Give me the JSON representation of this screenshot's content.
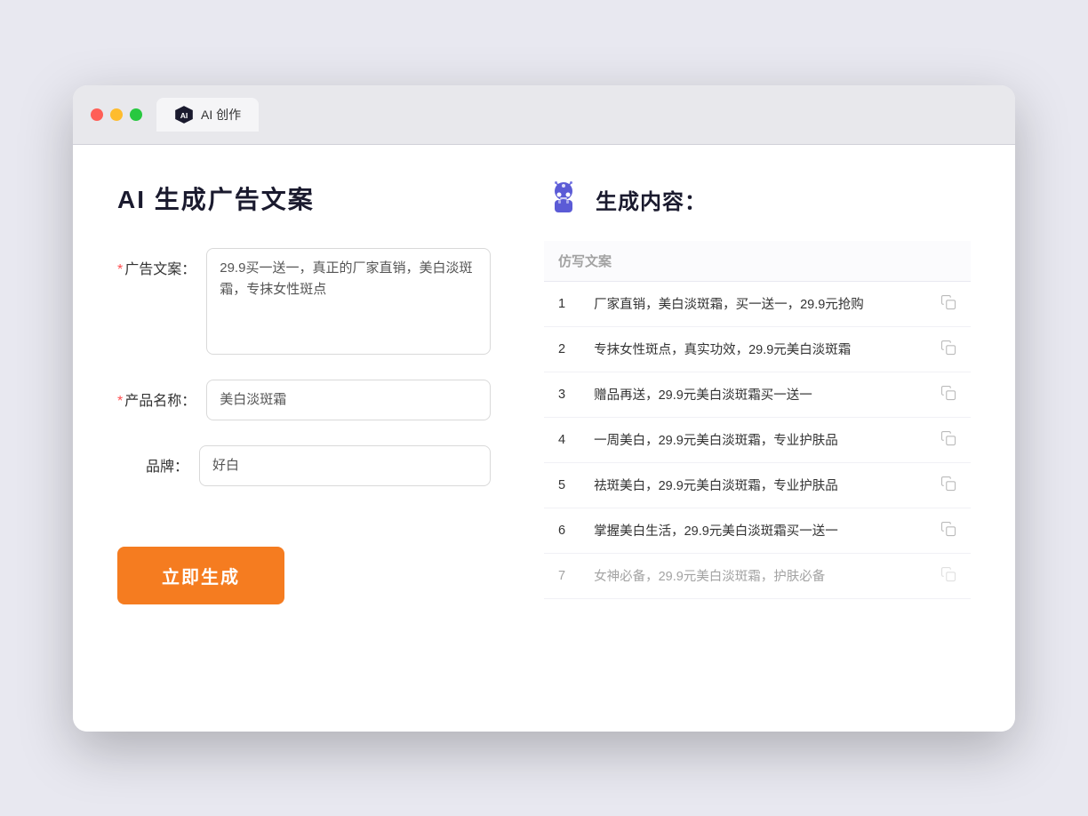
{
  "window": {
    "tab_label": "AI 创作"
  },
  "left_panel": {
    "title": "AI 生成广告文案",
    "form": {
      "ad_copy_label": "广告文案：",
      "ad_copy_required": "*",
      "ad_copy_value": "29.9买一送一，真正的厂家直销，美白淡斑霜，专抹女性斑点",
      "product_name_label": "产品名称：",
      "product_name_required": "*",
      "product_name_value": "美白淡斑霜",
      "brand_label": "品牌：",
      "brand_value": "好白",
      "generate_button": "立即生成"
    }
  },
  "right_panel": {
    "title": "生成内容：",
    "table_header": "仿写文案",
    "results": [
      {
        "num": 1,
        "text": "厂家直销，美白淡斑霜，买一送一，29.9元抢购"
      },
      {
        "num": 2,
        "text": "专抹女性斑点，真实功效，29.9元美白淡斑霜"
      },
      {
        "num": 3,
        "text": "赠品再送，29.9元美白淡斑霜买一送一"
      },
      {
        "num": 4,
        "text": "一周美白，29.9元美白淡斑霜，专业护肤品"
      },
      {
        "num": 5,
        "text": "祛斑美白，29.9元美白淡斑霜，专业护肤品"
      },
      {
        "num": 6,
        "text": "掌握美白生活，29.9元美白淡斑霜买一送一"
      },
      {
        "num": 7,
        "text": "女神必备，29.9元美白淡斑霜，护肤必备"
      }
    ]
  }
}
